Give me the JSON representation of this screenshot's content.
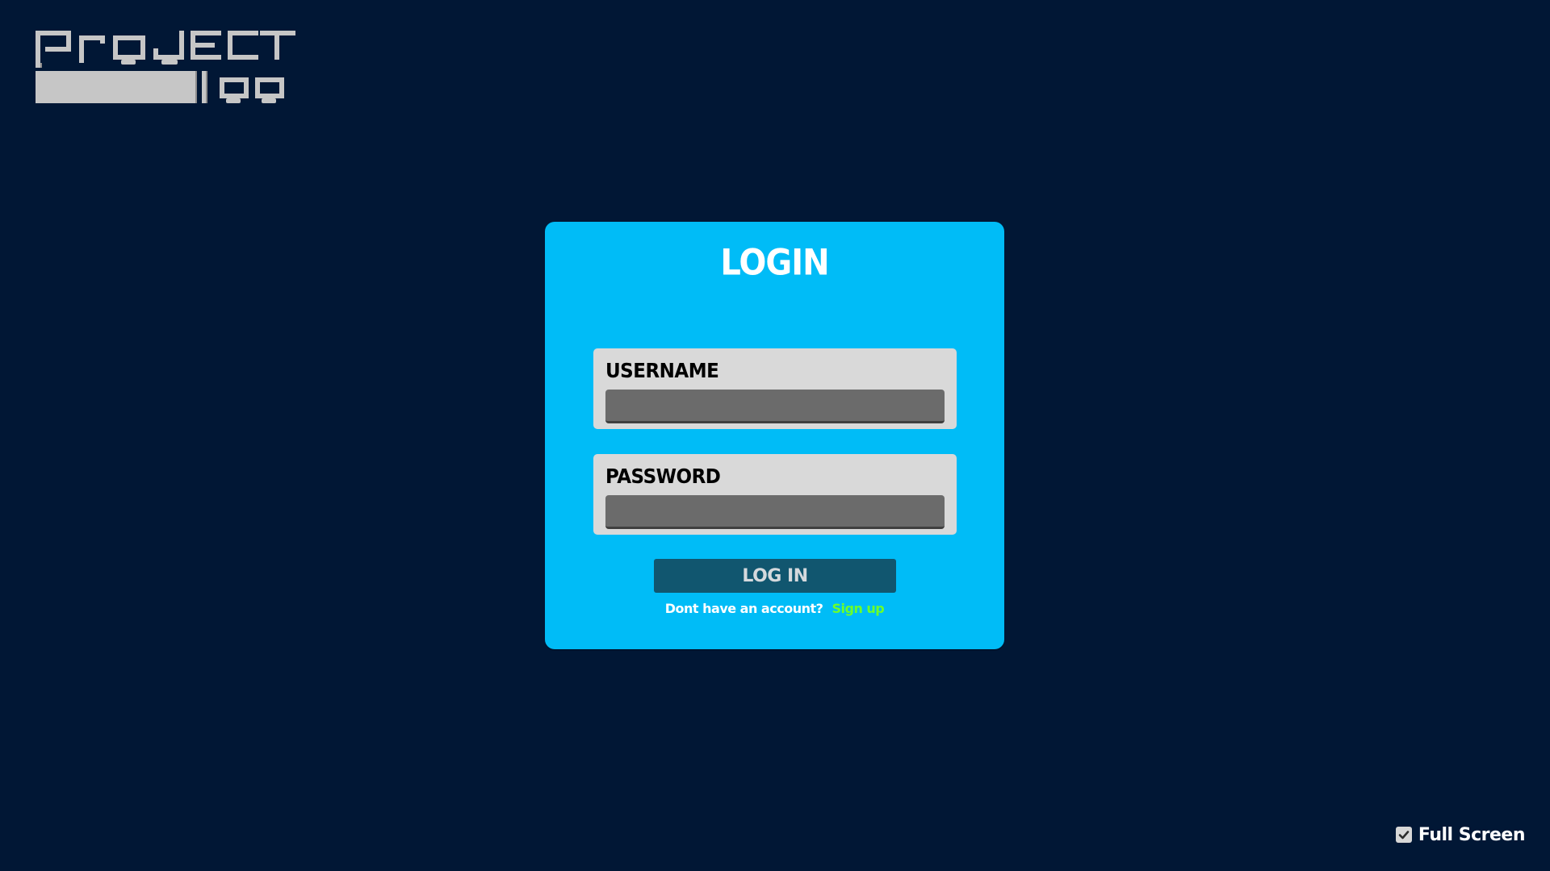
{
  "logo": {
    "text": "project 100"
  },
  "login": {
    "title": "LOGIN",
    "username": {
      "label": "USERNAME",
      "value": ""
    },
    "password": {
      "label": "PASSWORD",
      "value": ""
    },
    "submit_label": "LOG IN",
    "signup_prompt": "Dont have an account?",
    "signup_link": "Sign up"
  },
  "fullscreen": {
    "label": "Full Screen",
    "checked": true
  },
  "colors": {
    "background": "#011735",
    "card": "#00bcf7",
    "field": "#d9d9d9",
    "input": "#6b6b6b",
    "button": "#11566f",
    "link": "#6bff2a"
  },
  "icons": {
    "fullscreen_checkbox": "check-icon"
  }
}
